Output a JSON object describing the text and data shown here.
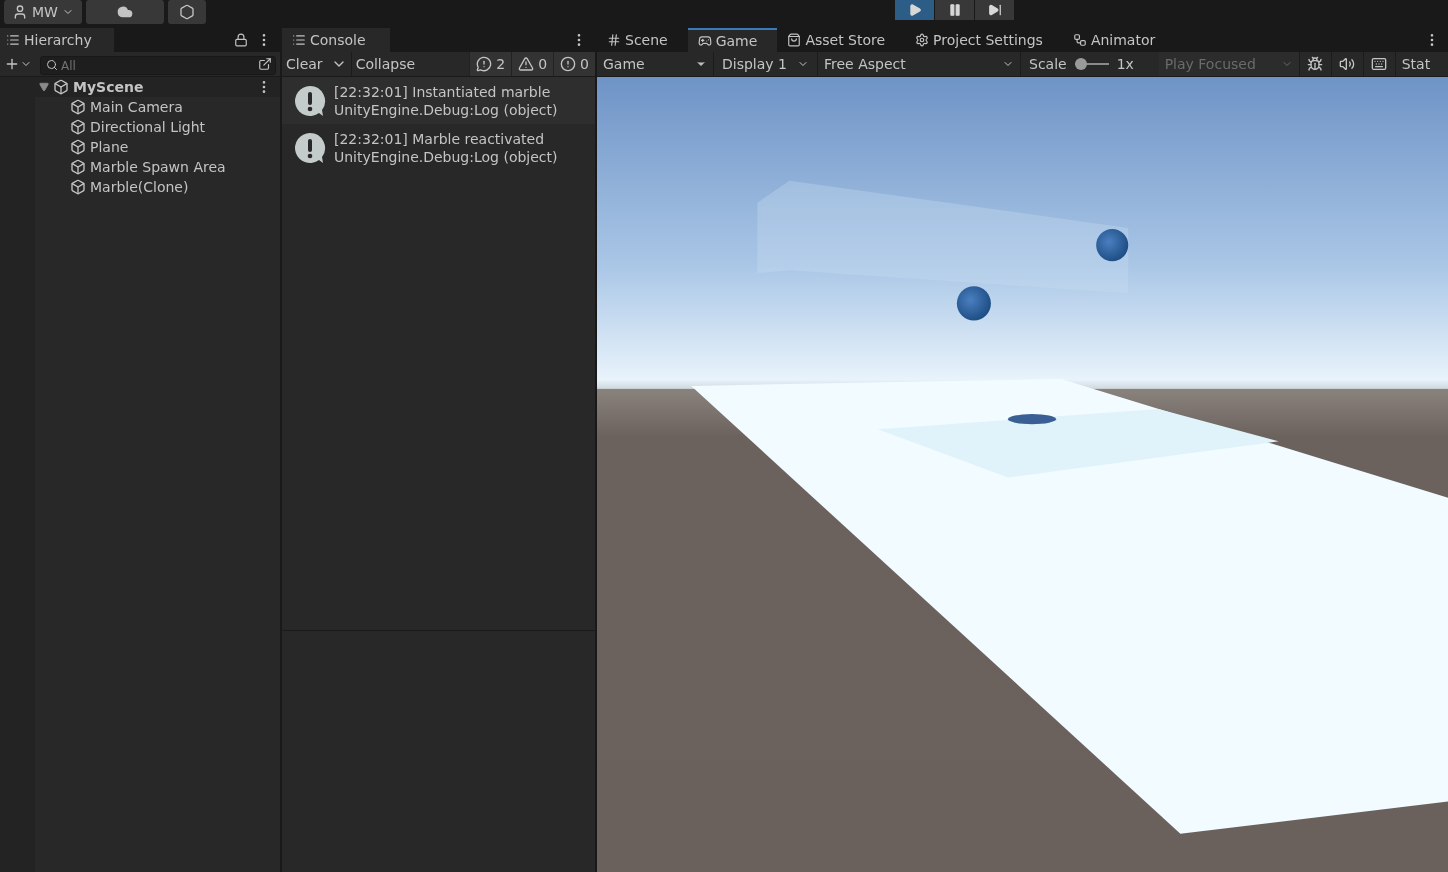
{
  "toolbar": {
    "account": "MW",
    "play_controls": [
      {
        "kind": "play",
        "selected": true
      },
      {
        "kind": "pause",
        "selected": false
      },
      {
        "kind": "step",
        "selected": false
      }
    ]
  },
  "hierarchy": {
    "tab": "Hierarchy",
    "search": {
      "placeholder": "All"
    },
    "scene": {
      "name": "MyScene",
      "expanded": true,
      "children": [
        {
          "name": "Main Camera"
        },
        {
          "name": "Directional Light"
        },
        {
          "name": "Plane"
        },
        {
          "name": "Marble Spawn Area"
        },
        {
          "name": "Marble(Clone)"
        }
      ]
    }
  },
  "console": {
    "tab": "Console",
    "buttons": [
      "Clear",
      "Collapse"
    ],
    "counters": [
      {
        "kind": "log",
        "count": "2"
      },
      {
        "kind": "warning",
        "count": "0"
      },
      {
        "kind": "error",
        "count": "0"
      }
    ],
    "entries": [
      {
        "message": "[22:32:01] Instantiated marble",
        "source": "UnityEngine.Debug:Log (object)"
      },
      {
        "message": "[22:32:01] Marble reactivated",
        "source": "UnityEngine.Debug:Log (object)"
      }
    ]
  },
  "view": {
    "tabs": [
      {
        "kind": "scene",
        "label": "Scene",
        "selected": false
      },
      {
        "kind": "game",
        "label": "Game",
        "selected": true
      },
      {
        "kind": "store",
        "label": "Asset Store",
        "selected": false
      },
      {
        "kind": "settings",
        "label": "Project Settings",
        "selected": false
      },
      {
        "kind": "animator",
        "label": "Animator",
        "selected": false
      }
    ],
    "toolbar": {
      "mode": "Game",
      "display": "Display 1",
      "aspect": "Free Aspect",
      "scale_label": "Scale",
      "scale": {
        "level": 0.0
      },
      "scale_value": "1x",
      "play_mode": {
        "label": "Play Focused",
        "disabled": true
      },
      "stats": "Stat"
    }
  }
}
